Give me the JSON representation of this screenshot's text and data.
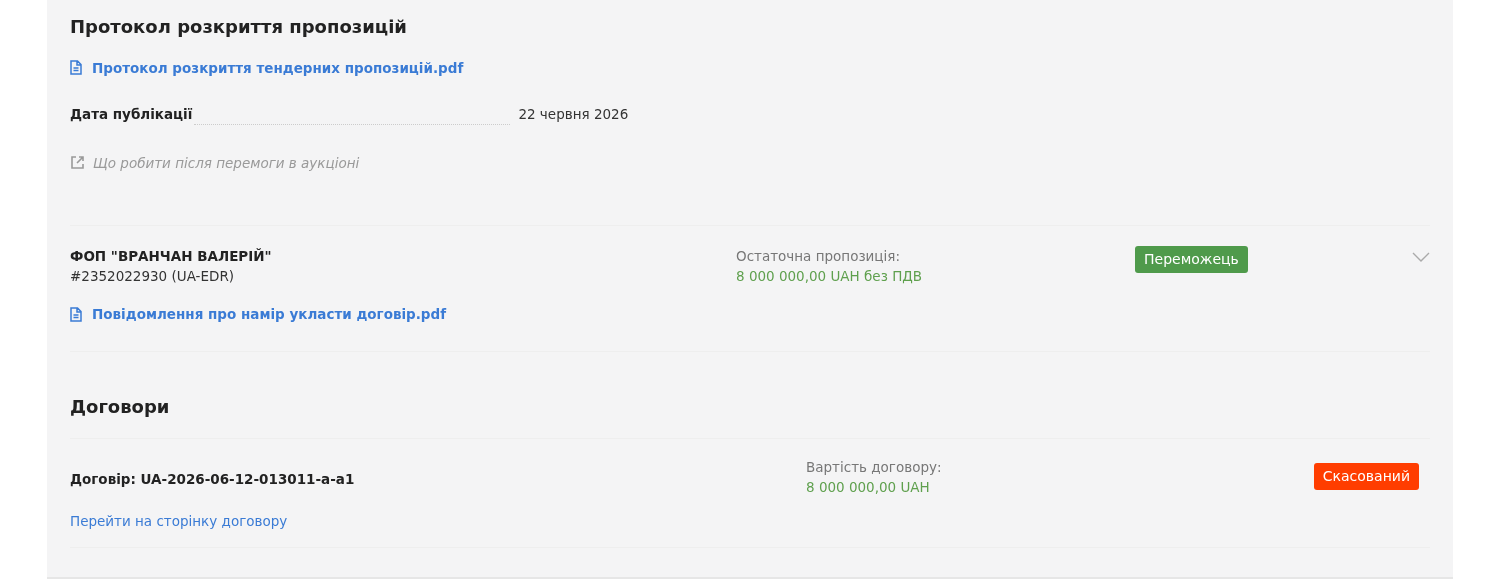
{
  "protocol": {
    "title": "Протокол розкриття пропозицій",
    "document": "Протокол розкриття тендерних пропозицій.pdf",
    "date_label": "Дата публікації",
    "date_value": "22 червня 2026",
    "help_link": "Що робити після перемоги в аукціоні"
  },
  "bidders": [
    {
      "name": "ФОП \"ВРАНЧАН ВАЛЕРІЙ\"",
      "identifier": "#2352022930 (UA-EDR)",
      "offer_label": "Остаточна пропозиція:",
      "offer_value": "8 000 000,00 UAH без ПДВ",
      "status": {
        "kind": "winner",
        "label": "Переможець"
      },
      "expanded": false,
      "document": "Повідомлення про намір укласти договір.pdf"
    }
  ],
  "contracts_title": "Договори",
  "contracts": [
    {
      "title": "Договір: UA-2026-06-12-013011-a-a1",
      "price_label": "Вартість договору:",
      "price_value": "8 000 000,00 UAH",
      "status": {
        "kind": "cancelled",
        "label": "Скасований"
      },
      "link": "Перейти на сторінку договору"
    }
  ]
}
